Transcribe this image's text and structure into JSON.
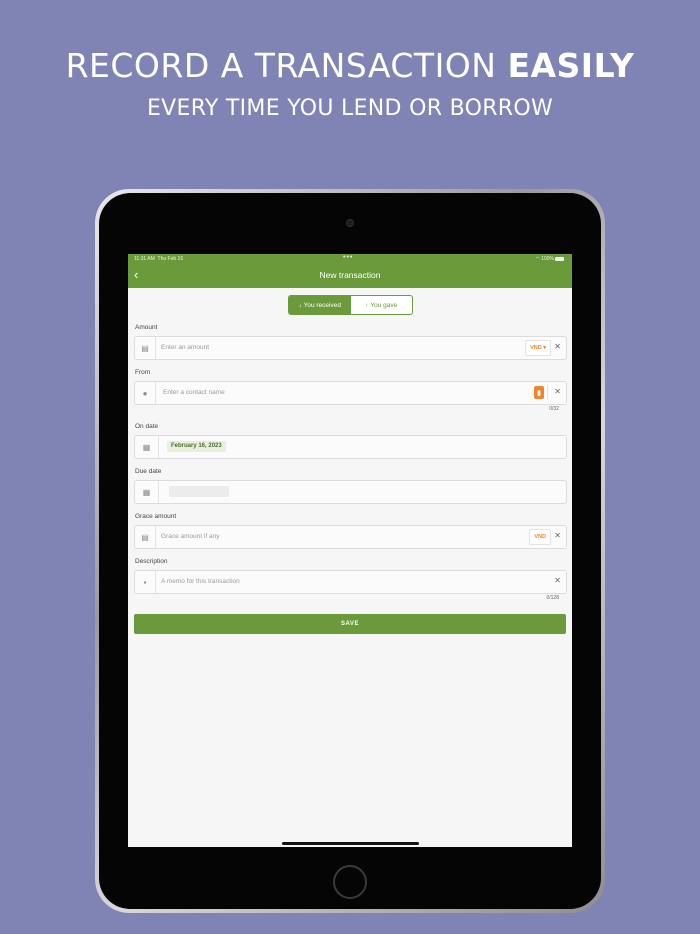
{
  "promo": {
    "headline_plain": "RECORD A TRANSACTION ",
    "headline_bold": "EASILY",
    "subheadline": "EVERY TIME YOU LEND OR BORROW"
  },
  "status_bar": {
    "time": "11:31 AM",
    "date": "Thu Feb 16",
    "battery": "100%"
  },
  "nav": {
    "back_icon": "chevron-left-icon",
    "title": "New transaction"
  },
  "direction_toggle": {
    "received_label": "You received",
    "gave_label": "You gave",
    "selected": "received"
  },
  "form": {
    "amount": {
      "label": "Amount",
      "placeholder": "Enter an amount",
      "currency": "VND ▾",
      "icon": "money-icon"
    },
    "from": {
      "label": "From",
      "placeholder": "Enter a contact name",
      "counter": "0/32",
      "icon": "person-icon"
    },
    "on_date": {
      "label": "On date",
      "value": "February 16, 2023",
      "icon": "calendar-icon"
    },
    "due_date": {
      "label": "Due date",
      "icon": "calendar-icon"
    },
    "grace_amount": {
      "label": "Grace amount",
      "placeholder": "Grace amount if any",
      "currency": "VND",
      "icon": "money-icon"
    },
    "description": {
      "label": "Description",
      "placeholder": "A memo for this transaction",
      "counter": "0/128",
      "icon": "note-icon"
    },
    "save_label": "SAVE"
  },
  "colors": {
    "background": "#7f84b4",
    "primary": "#6a9a3a",
    "accent": "#e8852b"
  }
}
